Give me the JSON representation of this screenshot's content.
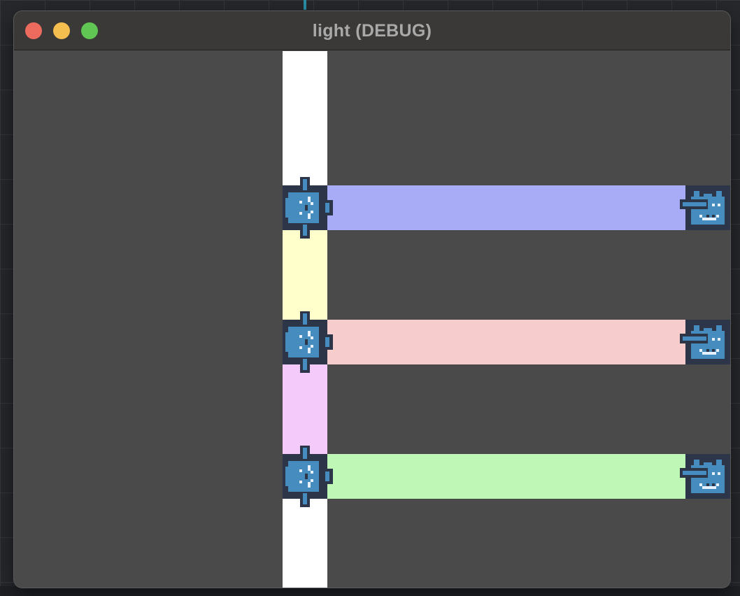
{
  "window": {
    "title": "light (DEBUG)",
    "traffic_lights": {
      "close_color": "#ed6a5e",
      "minimize_color": "#f5bf4f",
      "zoom_color": "#61c554"
    }
  },
  "scene": {
    "background_color": "#4a4a4a",
    "column_segments": [
      {
        "color": "#ffffff"
      },
      {
        "color": "#ffffcc"
      },
      {
        "color": "#f4cafa"
      },
      {
        "color": "#ffffff"
      }
    ],
    "beams": [
      {
        "color": "#a8acf7"
      },
      {
        "color": "#f6cccc"
      },
      {
        "color": "#bff8b6"
      }
    ],
    "emitter_icon": "godot-robot-light-emitter-icon",
    "receiver_icon": "godot-robot-light-receiver-icon",
    "sprite_colors": {
      "body": "#478cbf",
      "dark": "#2c3648",
      "light": "#e6f0ff"
    }
  }
}
